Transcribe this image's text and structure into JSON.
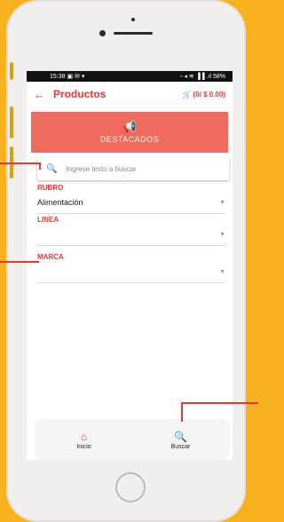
{
  "status_bar": {
    "time": "15:38",
    "left_icons": "▣ ✉ ▾",
    "right_icons": "▫ ◂ ≋ ▐▐ .ıl",
    "battery": "58%"
  },
  "appbar": {
    "back_icon": "←",
    "title": "Productos",
    "cart_icon": "🛒",
    "cart_text": "(0/ $ 0.00)"
  },
  "banner": {
    "icon": "📢",
    "label": "DESTACADOS"
  },
  "search": {
    "icon": "🔍",
    "placeholder": "Ingrese texto a buscar"
  },
  "fields": [
    {
      "label": "RUBRO",
      "value": "Alimentación"
    },
    {
      "label": "LINEA",
      "value": ""
    },
    {
      "label": "MARCA",
      "value": ""
    }
  ],
  "bottom_nav": [
    {
      "icon": "⌂",
      "label": "Inicio"
    },
    {
      "icon": "🔍",
      "label": "Buscar"
    }
  ],
  "colors": {
    "accent": "#e53935",
    "banner": "#ee6b5d",
    "background": "#f7b21d"
  }
}
